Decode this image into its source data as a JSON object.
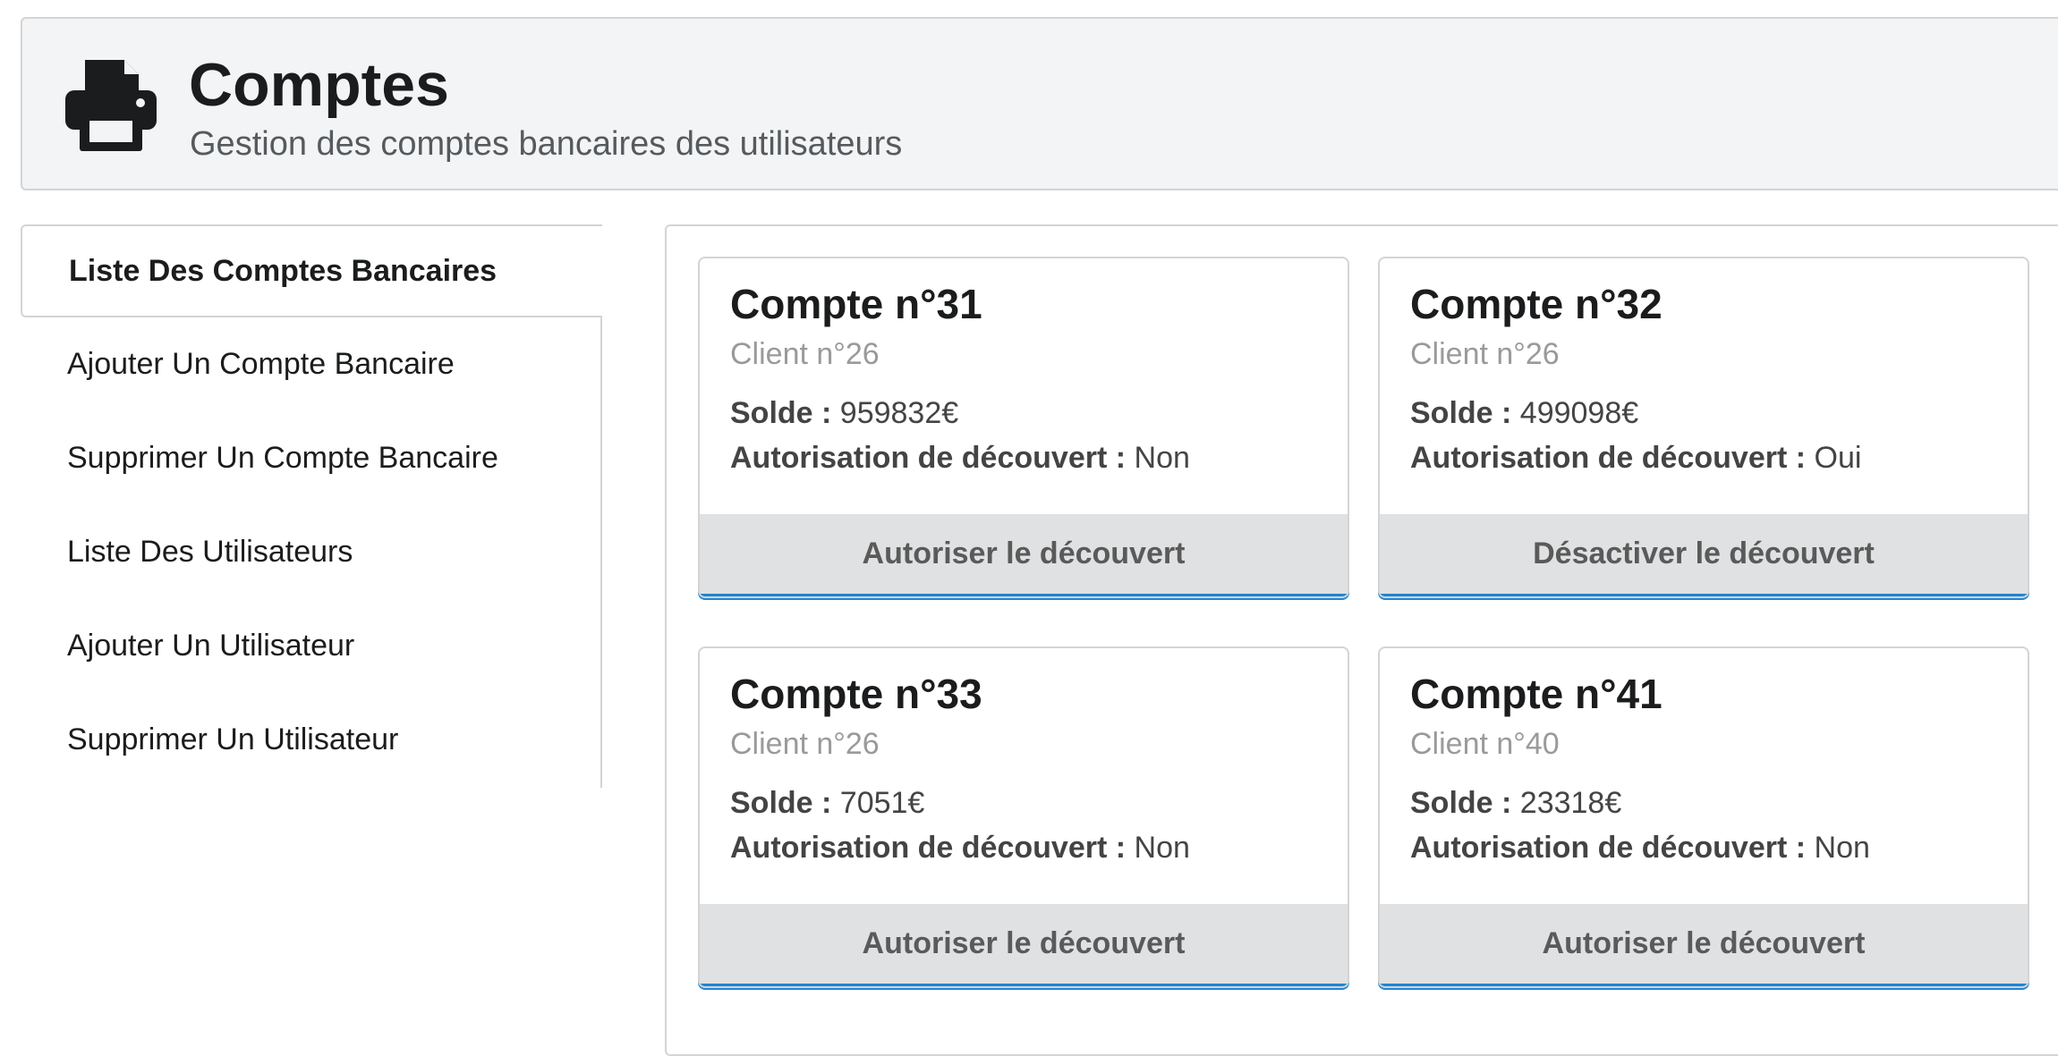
{
  "header": {
    "title": "Comptes",
    "subtitle": "Gestion des comptes bancaires des utilisateurs",
    "icon": "print-icon"
  },
  "sidebar": {
    "items": [
      {
        "label": "Liste Des Comptes Bancaires",
        "active": true
      },
      {
        "label": "Ajouter Un Compte Bancaire",
        "active": false
      },
      {
        "label": "Supprimer Un Compte Bancaire",
        "active": false
      },
      {
        "label": "Liste Des Utilisateurs",
        "active": false
      },
      {
        "label": "Ajouter Un Utilisateur",
        "active": false
      },
      {
        "label": "Supprimer Un Utilisateur",
        "active": false
      }
    ]
  },
  "labels": {
    "solde": "Solde :",
    "autorisation": "Autorisation de découvert :"
  },
  "accounts": [
    {
      "title": "Compte n°31",
      "client": "Client n°26",
      "solde": "959832€",
      "autorisation": "Non",
      "button": "Autoriser le découvert"
    },
    {
      "title": "Compte n°32",
      "client": "Client n°26",
      "solde": "499098€",
      "autorisation": "Oui",
      "button": "Désactiver le découvert"
    },
    {
      "title": "Compte n°33",
      "client": "Client n°26",
      "solde": "7051€",
      "autorisation": "Non",
      "button": "Autoriser le découvert"
    },
    {
      "title": "Compte n°41",
      "client": "Client n°40",
      "solde": "23318€",
      "autorisation": "Non",
      "button": "Autoriser le découvert"
    }
  ],
  "colors": {
    "header_bg": "#f3f4f5",
    "border": "#d4d4d5",
    "button_bg": "#e0e1e2",
    "accent": "#2185d0"
  }
}
